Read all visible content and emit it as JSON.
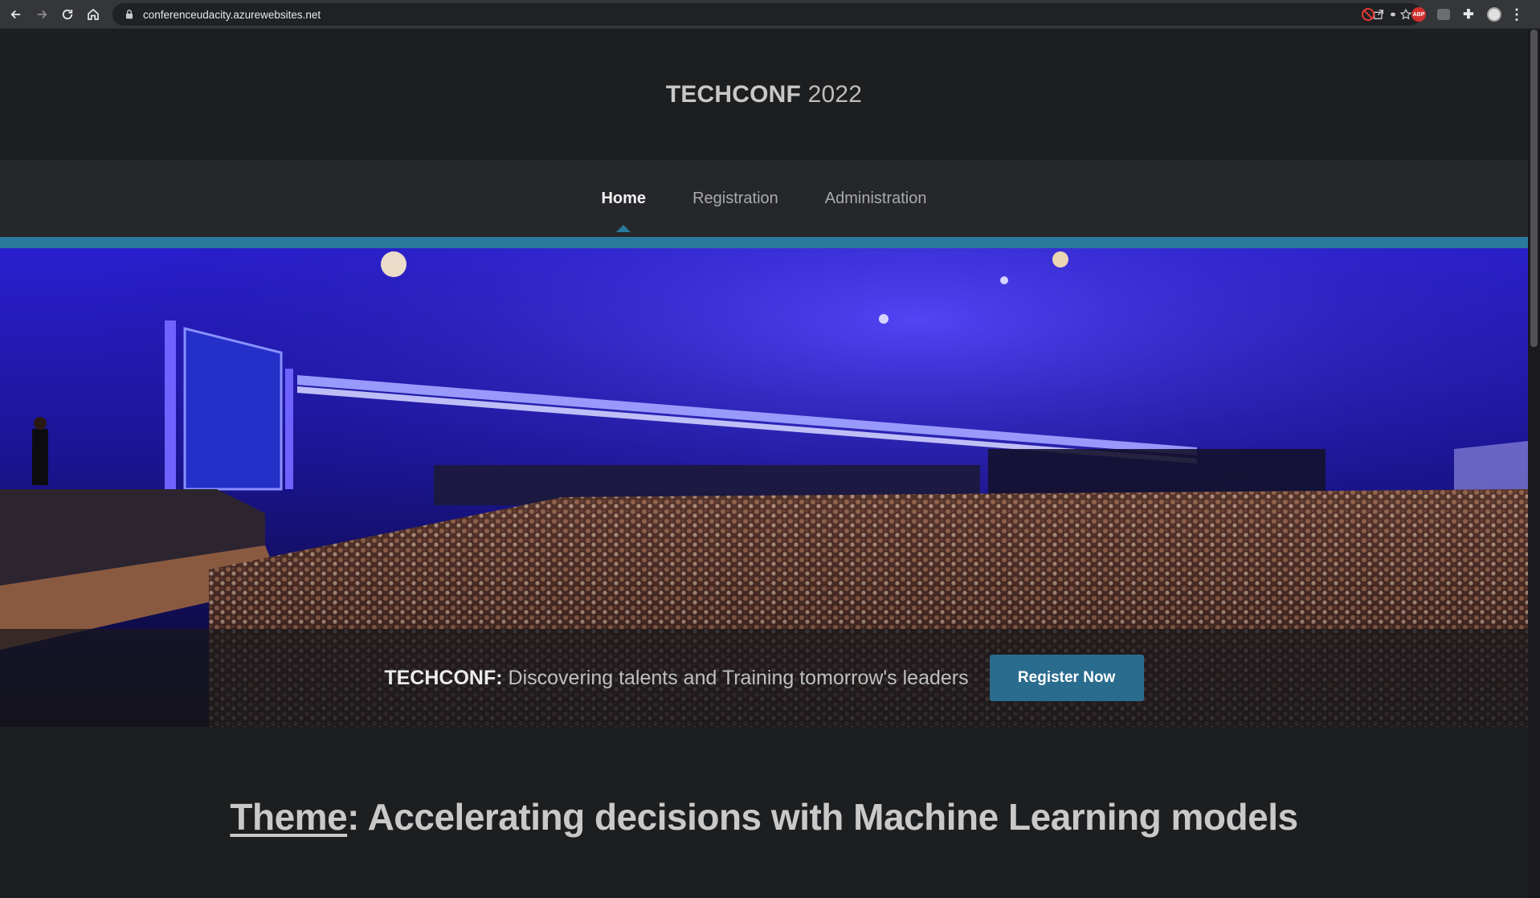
{
  "browser": {
    "url": "conferenceudacity.azurewebsites.net",
    "icons": [
      "back-icon",
      "forward-icon",
      "reload-icon",
      "home-icon",
      "lock-icon",
      "share-icon",
      "star-icon",
      "extension-icon",
      "menu-icon",
      "profile-avatar"
    ],
    "extension_badge": "ABP"
  },
  "header": {
    "brand_bold": "TECHCONF",
    "brand_year": "2022"
  },
  "nav": {
    "items": [
      {
        "label": "Home",
        "active": true
      },
      {
        "label": "Registration",
        "active": false
      },
      {
        "label": "Administration",
        "active": false
      }
    ]
  },
  "hero": {
    "tagline_bold": "TECHCONF:",
    "tagline_text": "Discovering talents and Training tomorrow's leaders",
    "cta_label": "Register Now"
  },
  "theme": {
    "label": "Theme",
    "text": ": Accelerating decisions with Machine Learning models"
  },
  "colors": {
    "accent": "#2a7a9e",
    "cta": "#2a6c8e",
    "background": "#1d1e20",
    "nav_background": "#26272a"
  }
}
